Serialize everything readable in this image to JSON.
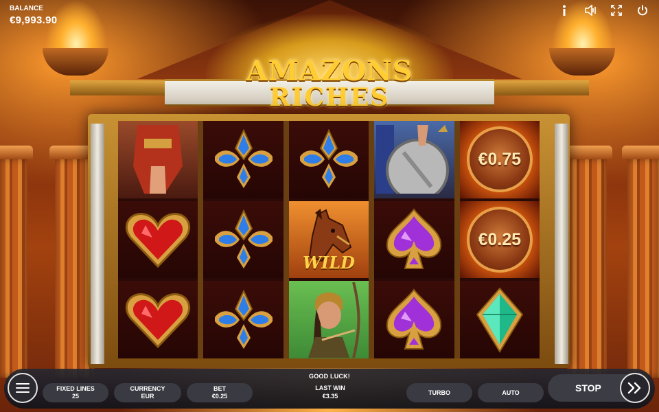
{
  "balance": {
    "label": "BALANCE",
    "value": "€9,993.90"
  },
  "top_icons": [
    {
      "name": "info-icon",
      "glyph": "i"
    },
    {
      "name": "sound-icon",
      "glyph": "🔈"
    },
    {
      "name": "fullscreen-icon",
      "glyph": "⤢"
    },
    {
      "name": "power-icon",
      "glyph": "⏻"
    }
  ],
  "title": {
    "line1": "AMAZONS",
    "line2": "RICHES"
  },
  "reels": [
    [
      "amazon-warrior-partial",
      "red-heart",
      "red-heart"
    ],
    [
      "blue-fleur",
      "blue-fleur",
      "blue-fleur"
    ],
    [
      "blue-fleur",
      "horse-wild",
      "amazon-archer"
    ],
    [
      "shield-warrior",
      "purple-spade",
      "purple-spade"
    ],
    [
      "coin",
      "coin",
      "green-crystal"
    ]
  ],
  "coin_values": {
    "reel5_row1": "€0.75",
    "reel5_row2": "€0.25"
  },
  "wild_label": "WILD",
  "status_message": "GOOD LUCK!",
  "controls": {
    "fixed_lines": {
      "label": "FIXED LINES",
      "value": "25"
    },
    "currency": {
      "label": "CURRENCY",
      "value": "EUR"
    },
    "bet": {
      "label": "BET",
      "value": "€0.25"
    },
    "last_win": {
      "label": "LAST WIN",
      "value": "€3.35"
    },
    "turbo_label": "TURBO",
    "auto_label": "AUTO",
    "stop_label": "STOP"
  },
  "colors": {
    "gold": "#ffcc33",
    "panel": "#3a3a42",
    "accent_white": "#ffffff"
  }
}
